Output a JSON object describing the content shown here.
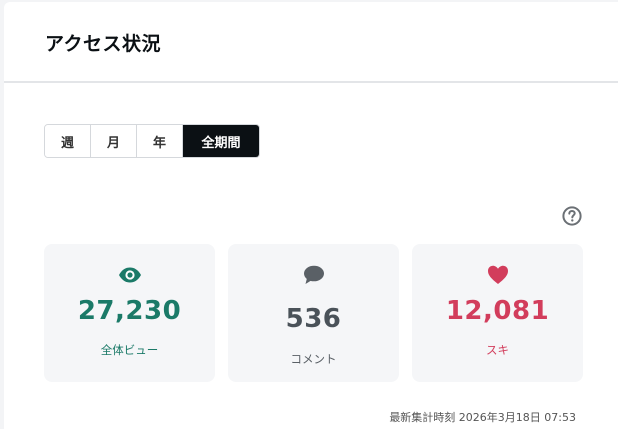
{
  "header": {
    "title": "アクセス状況"
  },
  "tabs": [
    {
      "label": "週",
      "active": false
    },
    {
      "label": "月",
      "active": false
    },
    {
      "label": "年",
      "active": false
    },
    {
      "label": "全期間",
      "active": true
    }
  ],
  "help": {
    "icon": "question-circle-icon"
  },
  "stats": {
    "views": {
      "value": "27,230",
      "label": "全体ビュー",
      "icon": "eye-icon",
      "color": "#1b7a68"
    },
    "comments": {
      "value": "536",
      "label": "コメント",
      "icon": "speech-bubble-icon",
      "color": "#4a5259"
    },
    "likes": {
      "value": "12,081",
      "label": "スキ",
      "icon": "heart-icon",
      "color": "#d23d5c"
    }
  },
  "footer": {
    "updated": "最新集計時刻 2026年3月18日 07:53"
  }
}
